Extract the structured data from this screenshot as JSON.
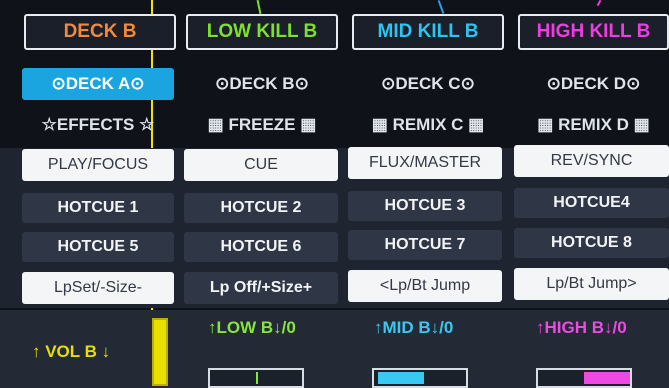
{
  "header": [
    {
      "label": "DECK B",
      "color": "#f08a3c"
    },
    {
      "label": "LOW KILL B",
      "color": "#7ee02a"
    },
    {
      "label": "MID KILL B",
      "color": "#2cc4f0"
    },
    {
      "label": "HIGH KILL B",
      "color": "#ec3ee0"
    }
  ],
  "decks": [
    "⊙DECK A⊙",
    "⊙DECK B⊙",
    "⊙DECK C⊙",
    "⊙DECK D⊙"
  ],
  "modes": [
    "☆EFFECTS ☆",
    "▦ FREEZE ▦",
    "▦ REMIX C ▦",
    "▦ REMIX D ▦"
  ],
  "transport": [
    "PLAY/FOCUS",
    "CUE",
    "FLUX/MASTER",
    "REV/SYNC"
  ],
  "hotcues_row1": [
    "HOTCUE 1",
    "HOTCUE 2",
    "HOTCUE 3",
    "HOTCUE4"
  ],
  "hotcues_row2": [
    "HOTCUE 5",
    "HOTCUE 6",
    "HOTCUE 7",
    "HOTCUE 8"
  ],
  "loops": [
    "LpSet/-Size-",
    "Lp Off/+Size+",
    "<Lp/Bt Jump",
    "Lp/Bt Jump>"
  ],
  "controls": {
    "vol": {
      "label": "↑ VOL B ↓",
      "color": "#e8df00"
    },
    "low": {
      "label": "↑LOW B↓/0",
      "color": "#86e63a"
    },
    "mid": {
      "label": "↑MID B↓/0",
      "color": "#39c8f2"
    },
    "high": {
      "label": "↑HIGH B↓/0",
      "color": "#ef49e3"
    }
  },
  "colors": {
    "active_deck": "#1ba5e0",
    "wire_yellow": "#f2e200",
    "wire_green": "#7ee02a",
    "wire_blue": "#2c9cf0",
    "wire_pink": "#ec3ee0"
  }
}
